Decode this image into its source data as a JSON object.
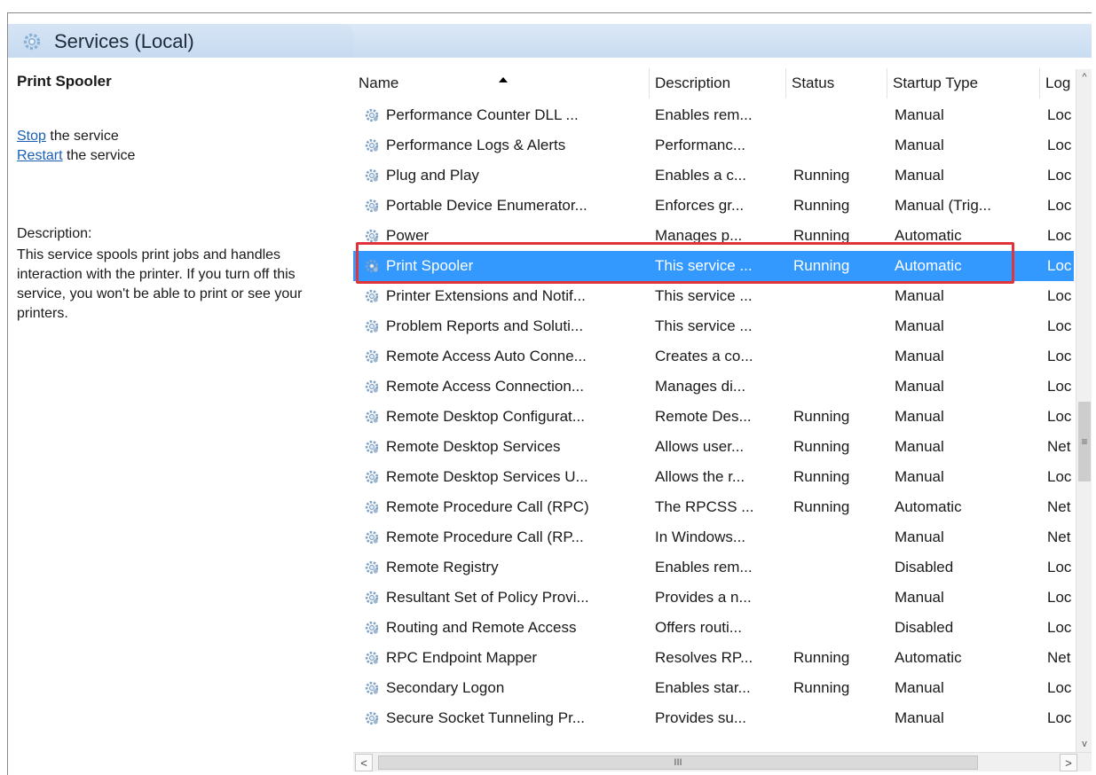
{
  "header": {
    "title": "Services (Local)"
  },
  "left_pane": {
    "service_name": "Print Spooler",
    "stop_link": "Stop",
    "stop_suffix": " the service",
    "restart_link": "Restart",
    "restart_suffix": " the service",
    "description_label": "Description:",
    "description_text": "This service spools print jobs and handles interaction with the printer. If you turn off this service, you won't be able to print or see your printers."
  },
  "columns": {
    "name": "Name",
    "description": "Description",
    "status": "Status",
    "startup_type": "Startup Type",
    "log_on_as": "Log"
  },
  "rows": [
    {
      "name": "Performance Counter DLL ...",
      "description": "Enables rem...",
      "status": "",
      "startup": "Manual",
      "log": "Loc"
    },
    {
      "name": "Performance Logs & Alerts",
      "description": "Performanc...",
      "status": "",
      "startup": "Manual",
      "log": "Loc"
    },
    {
      "name": "Plug and Play",
      "description": "Enables a c...",
      "status": "Running",
      "startup": "Manual",
      "log": "Loc"
    },
    {
      "name": "Portable Device Enumerator...",
      "description": "Enforces gr...",
      "status": "Running",
      "startup": "Manual (Trig...",
      "log": "Loc"
    },
    {
      "name": "Power",
      "description": "Manages p...",
      "status": "Running",
      "startup": "Automatic",
      "log": "Loc"
    },
    {
      "name": "Print Spooler",
      "description": "This service ...",
      "status": "Running",
      "startup": "Automatic",
      "log": "Loc"
    },
    {
      "name": "Printer Extensions and Notif...",
      "description": "This service ...",
      "status": "",
      "startup": "Manual",
      "log": "Loc"
    },
    {
      "name": "Problem Reports and Soluti...",
      "description": "This service ...",
      "status": "",
      "startup": "Manual",
      "log": "Loc"
    },
    {
      "name": "Remote Access Auto Conne...",
      "description": "Creates a co...",
      "status": "",
      "startup": "Manual",
      "log": "Loc"
    },
    {
      "name": "Remote Access Connection...",
      "description": "Manages di...",
      "status": "",
      "startup": "Manual",
      "log": "Loc"
    },
    {
      "name": "Remote Desktop Configurat...",
      "description": "Remote Des...",
      "status": "Running",
      "startup": "Manual",
      "log": "Loc"
    },
    {
      "name": "Remote Desktop Services",
      "description": "Allows user...",
      "status": "Running",
      "startup": "Manual",
      "log": "Net"
    },
    {
      "name": "Remote Desktop Services U...",
      "description": "Allows the r...",
      "status": "Running",
      "startup": "Manual",
      "log": "Loc"
    },
    {
      "name": "Remote Procedure Call (RPC)",
      "description": "The RPCSS ...",
      "status": "Running",
      "startup": "Automatic",
      "log": "Net"
    },
    {
      "name": "Remote Procedure Call (RP...",
      "description": "In Windows...",
      "status": "",
      "startup": "Manual",
      "log": "Net"
    },
    {
      "name": "Remote Registry",
      "description": "Enables rem...",
      "status": "",
      "startup": "Disabled",
      "log": "Loc"
    },
    {
      "name": "Resultant Set of Policy Provi...",
      "description": "Provides a n...",
      "status": "",
      "startup": "Manual",
      "log": "Loc"
    },
    {
      "name": "Routing and Remote Access",
      "description": "Offers routi...",
      "status": "",
      "startup": "Disabled",
      "log": "Loc"
    },
    {
      "name": "RPC Endpoint Mapper",
      "description": "Resolves RP...",
      "status": "Running",
      "startup": "Automatic",
      "log": "Net"
    },
    {
      "name": "Secondary Logon",
      "description": "Enables star...",
      "status": "Running",
      "startup": "Manual",
      "log": "Loc"
    },
    {
      "name": "Secure Socket Tunneling Pr...",
      "description": "Provides su...",
      "status": "",
      "startup": "Manual",
      "log": "Loc"
    }
  ],
  "selected_row": "Print Spooler",
  "colors": {
    "selection": "#3399ff",
    "highlight_box": "#e0333a",
    "link": "#1a5fb4"
  },
  "scroll": {
    "up_glyph": "^",
    "down_glyph": "v",
    "grip_glyph": "≡",
    "left_glyph": "<",
    "right_glyph": ">",
    "hgrip_glyph": "III"
  }
}
